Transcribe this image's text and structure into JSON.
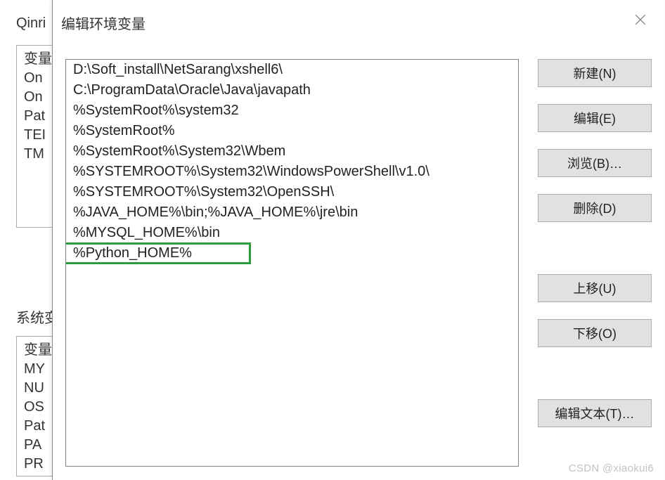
{
  "bg": {
    "tab_label": "Qinri",
    "user_section_label": "变量",
    "user_vars": [
      "变量",
      "On",
      "On",
      "Pat",
      "TEI",
      "TM"
    ],
    "sys_section_label": "系统变",
    "sys_vars": [
      "变量",
      "MY",
      "NU",
      "OS",
      "Pat",
      "PA",
      "PR"
    ]
  },
  "dialog": {
    "title": "编辑环境变量",
    "close_aria": "Close",
    "paths": [
      "D:\\Soft_install\\NetSarang\\xshell6\\",
      "C:\\ProgramData\\Oracle\\Java\\javapath",
      "%SystemRoot%\\system32",
      "%SystemRoot%",
      "%SystemRoot%\\System32\\Wbem",
      "%SYSTEMROOT%\\System32\\WindowsPowerShell\\v1.0\\",
      "%SYSTEMROOT%\\System32\\OpenSSH\\",
      "%JAVA_HOME%\\bin;%JAVA_HOME%\\jre\\bin",
      "%MYSQL_HOME%\\bin",
      "%Python_HOME%"
    ],
    "highlight_index": 9,
    "buttons": {
      "new": "新建(N)",
      "edit": "编辑(E)",
      "browse": "浏览(B)…",
      "delete": "删除(D)",
      "move_up": "上移(U)",
      "move_down": "下移(O)",
      "edit_text": "编辑文本(T)…"
    }
  },
  "watermark": "CSDN @xiaokui6"
}
